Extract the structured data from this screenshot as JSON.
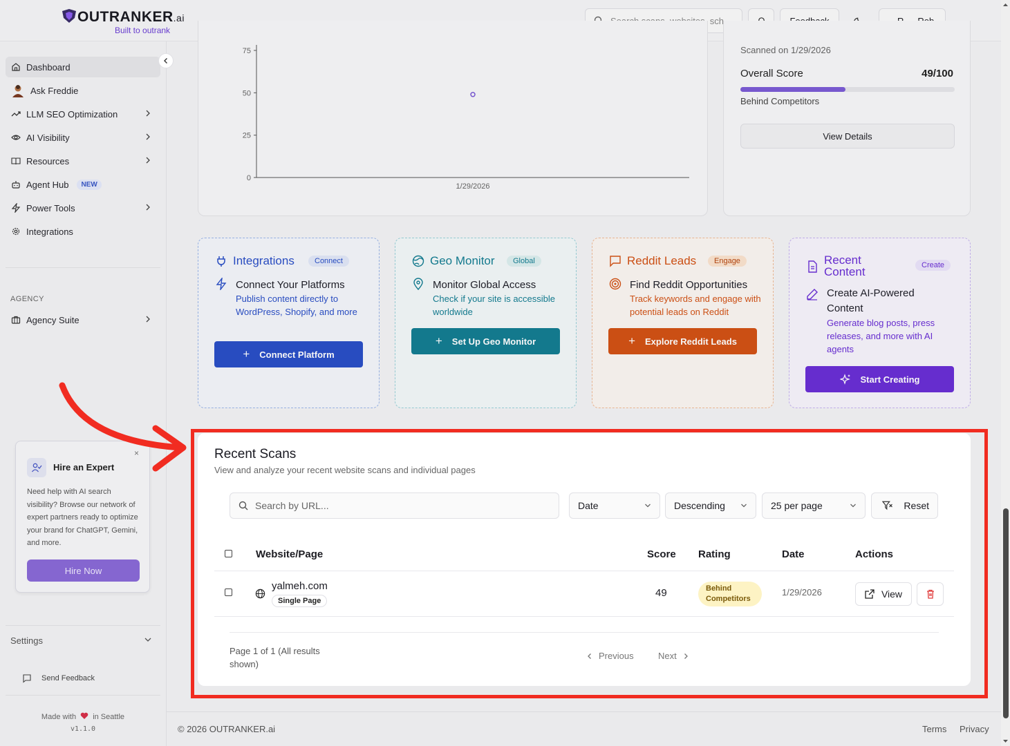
{
  "brand": {
    "name": "OUTRANKER",
    "suffix": ".ai",
    "tagline": "Built to outrank"
  },
  "header": {
    "search_placeholder": "Search scans, websites, sch",
    "feedback_label": "Feedback",
    "user_initial": "R",
    "user_name": "Rob"
  },
  "sidebar": {
    "items": [
      {
        "label": "Dashboard",
        "icon": "home-icon"
      },
      {
        "label": "Ask Freddie",
        "icon": "avatar"
      },
      {
        "label": "LLM SEO Optimization",
        "icon": "trending-up-icon"
      },
      {
        "label": "AI Visibility",
        "icon": "eye-icon"
      },
      {
        "label": "Resources",
        "icon": "book-icon"
      },
      {
        "label": "Agent Hub",
        "icon": "bot-icon",
        "badge": "NEW"
      },
      {
        "label": "Power Tools",
        "icon": "zap-icon"
      },
      {
        "label": "Integrations",
        "icon": "gear-icon"
      }
    ],
    "agency_label": "AGENCY",
    "agency_item": "Agency Suite",
    "settings_label": "Settings",
    "send_feedback": "Send Feedback",
    "made_with_pre": "Made with",
    "made_with_post": "in Seattle",
    "version": "v1.1.0"
  },
  "expert_card": {
    "title": "Hire an Expert",
    "close": "×",
    "body": "Need help with AI search visibility? Browse our network of expert partners ready to optimize your brand for ChatGPT, Gemini, and more.",
    "button": "Hire Now"
  },
  "chart_data": {
    "type": "scatter",
    "title": "",
    "xlabel": "",
    "ylabel": "",
    "x": [
      "1/29/2026"
    ],
    "values": [
      49
    ],
    "y_ticks": [
      "75",
      "50",
      "25",
      "0"
    ],
    "ylim": [
      0,
      75
    ],
    "grid": false
  },
  "score_card": {
    "scanned_on": "Scanned on 1/29/2026",
    "overall_label": "Overall Score",
    "overall_value": "49/100",
    "progress": 0.49,
    "status": "Behind Competitors",
    "button": "View Details"
  },
  "features": [
    {
      "title": "Integrations",
      "tag": "Connect",
      "sub_title": "Connect Your Platforms",
      "desc": "Publish content directly to WordPress, Shopify, and more",
      "button": "Connect Platform",
      "color": "#2a4fc7"
    },
    {
      "title": "Geo Monitor",
      "tag": "Global",
      "sub_title": "Monitor Global Access",
      "desc": "Check if your site is accessible worldwide",
      "button": "Set Up Geo Monitor",
      "color": "#147e93"
    },
    {
      "title": "Reddit Leads",
      "tag": "Engage",
      "sub_title": "Find Reddit Opportunities",
      "desc": "Track keywords and engage with potential leads on Reddit",
      "button": "Explore Reddit Leads",
      "color": "#d35215"
    },
    {
      "title_line1": "Recent",
      "title_line2": "Content",
      "tag": "Create",
      "sub_title_line1": "Create AI-Powered",
      "sub_title_line2": "Content",
      "desc": "Generate blog posts, press releases, and more with AI agents",
      "button": "Start Creating",
      "color": "#6a2fd6"
    }
  ],
  "recent_scans": {
    "title": "Recent Scans",
    "subtitle": "View and analyze your recent website scans and individual pages",
    "search_placeholder": "Search by URL...",
    "sort_field": "Date",
    "sort_order": "Descending",
    "per_page": "25 per page",
    "reset_label": "Reset",
    "columns": [
      "Website/Page",
      "Score",
      "Rating",
      "Date",
      "Actions"
    ],
    "rows": [
      {
        "site": "yalmeh.com",
        "type": "Single Page",
        "score": "49",
        "rating_line1": "Behind",
        "rating_line2": "Competitors",
        "date": "1/29/2026",
        "view_label": "View"
      }
    ],
    "pagination_line1": "Page 1 of 1 (All results",
    "pagination_line2": "shown)",
    "previous": "Previous",
    "next": "Next"
  },
  "footer": {
    "copyright": "© 2026 OUTRANKER.ai",
    "terms": "Terms",
    "privacy": "Privacy"
  },
  "colors": {
    "brand_purple": "#6b3fd6",
    "highlight_red": "#f12c21",
    "progress_fill": "#7c5cd6",
    "delete_red": "#e03a3a"
  }
}
